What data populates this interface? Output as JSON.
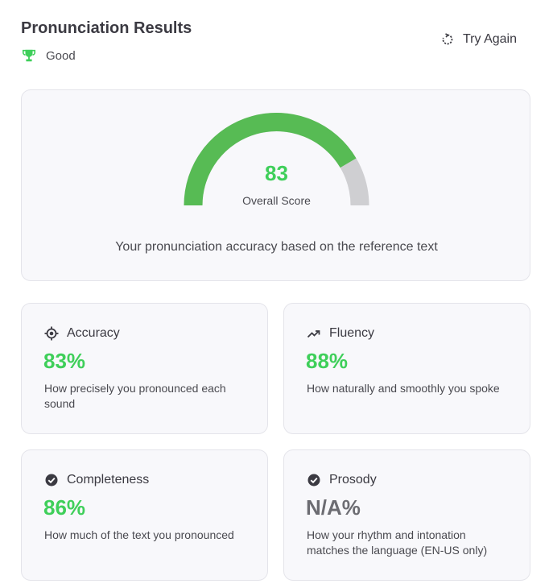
{
  "header": {
    "title": "Pronunciation Results",
    "rating_label": "Good",
    "try_again_label": "Try Again"
  },
  "overall": {
    "score": "83",
    "score_fraction": 0.83,
    "score_label": "Overall Score",
    "description": "Your pronunciation accuracy based on the reference text"
  },
  "metrics": [
    {
      "title": "Accuracy",
      "value": "83%",
      "description": "How precisely you pronounced each sound",
      "icon": "target-icon"
    },
    {
      "title": "Fluency",
      "value": "88%",
      "description": "How naturally and smoothly you spoke",
      "icon": "trending-up-icon"
    },
    {
      "title": "Completeness",
      "value": "86%",
      "description": "How much of the text you pronounced",
      "icon": "check-circle-icon"
    },
    {
      "title": "Prosody",
      "value": "N/A%",
      "description": "How your rhythm and intonation matches the language (EN-US only)",
      "icon": "check-circle-icon"
    }
  ],
  "colors": {
    "accent": "#3fcf5a",
    "gauge_fill": "#57bb54",
    "gauge_track": "#cfcfd2",
    "na_value": "#6c6c72"
  }
}
